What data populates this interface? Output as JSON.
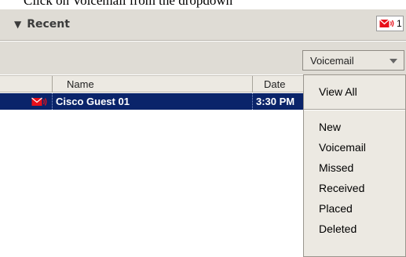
{
  "caption": "Click on Voicemail from the dropdown",
  "recent": {
    "title": "Recent",
    "voicemail_count": "1"
  },
  "filter": {
    "selected": "Voicemail"
  },
  "table": {
    "columns": [
      "Name",
      "Date"
    ],
    "rows": [
      {
        "name": "Cisco Guest 01",
        "date": "3:30 PM"
      }
    ]
  },
  "dropdown": {
    "items": [
      "View All",
      "New",
      "Voicemail",
      "Missed",
      "Received",
      "Placed",
      "Deleted"
    ]
  },
  "colors": {
    "selection": "#0a246a",
    "voicemail_icon": "#e8101a",
    "panel": "#dfdcd5"
  },
  "icons": {
    "collapse": "triangle-down-icon",
    "voicemail": "voicemail-envelope-icon"
  }
}
